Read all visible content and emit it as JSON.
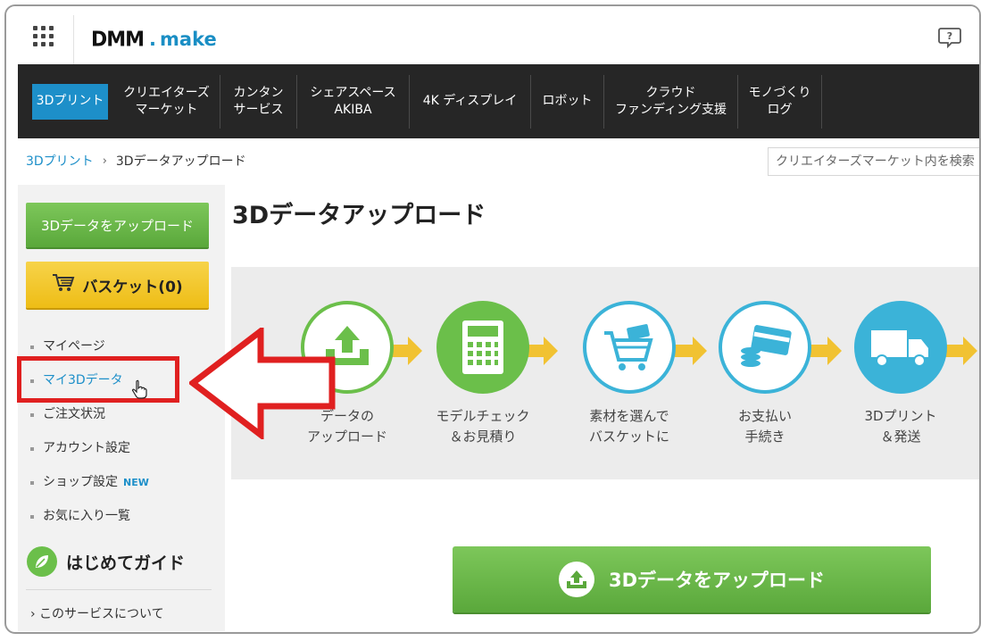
{
  "header": {
    "logo_main": "DMM",
    "logo_dot": ".",
    "logo_sub": "make",
    "grid_icon": "apps-grid-icon",
    "help_icon": "help-chat-icon"
  },
  "nav": {
    "items": [
      {
        "label": "3Dプリント"
      },
      {
        "label": "クリエイターズ\nマーケット"
      },
      {
        "label": "カンタン\nサービス"
      },
      {
        "label": "シェアスペース\nAKIBA"
      },
      {
        "label": "4K ディスプレイ"
      },
      {
        "label": "ロボット"
      },
      {
        "label": "クラウド\nファンディング支援"
      },
      {
        "label": "モノづくり\nログ"
      }
    ],
    "active_color": "#1d8fc9"
  },
  "breadcrumb": {
    "home": "3Dプリント",
    "separator": "›",
    "current": "3Dデータアップロード"
  },
  "search": {
    "placeholder": "クリエイターズマーケット内を検索"
  },
  "sidebar": {
    "upload_button": "3Dデータをアップロード",
    "basket_button": "バスケット(0)",
    "menu": [
      {
        "label": "マイページ"
      },
      {
        "label": "マイ3Dデータ"
      },
      {
        "label": "ご注文状況"
      },
      {
        "label": "アカウント設定"
      },
      {
        "label": "ショップ設定",
        "badge": "NEW"
      },
      {
        "label": "お気に入り一覧"
      }
    ],
    "guide_title": "はじめてガイド",
    "about_link": "› このサービスについて"
  },
  "main": {
    "title": "3Dデータアップロード",
    "steps": [
      {
        "label": "データの\nアップロード",
        "icon": "upload-tray-icon"
      },
      {
        "label": "モデルチェック\n＆お見積り",
        "icon": "calculator-icon"
      },
      {
        "label": "素材を選んで\nバスケットに",
        "icon": "shopping-cart-icon"
      },
      {
        "label": "お支払い\n手続き",
        "icon": "payment-card-icon"
      },
      {
        "label": "3Dプリント\n＆発送",
        "icon": "delivery-truck-icon"
      }
    ],
    "upload_big_button": "3Dデータをアップロード"
  },
  "colors": {
    "green": "#6bbf4a",
    "blue": "#1d8fc9",
    "yellow": "#f1c232",
    "annotation_red": "#e02020"
  }
}
